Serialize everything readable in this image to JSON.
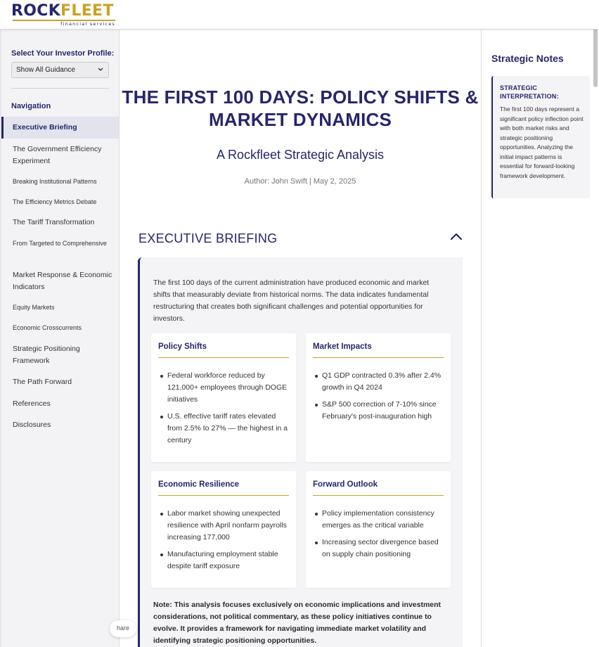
{
  "brand": {
    "name_part1": "ROCK",
    "name_part2": "FLEET",
    "tagline": "financial services",
    "colors": {
      "navy": "#25266b",
      "gold": "#c9a227"
    }
  },
  "sidebar": {
    "profile_label": "Select Your Investor Profile:",
    "profile_selected": "Show All Guidance",
    "nav_heading": "Navigation",
    "items": [
      {
        "label": "Executive Briefing",
        "active": true
      },
      {
        "label": "The Government Efficiency Experiment"
      },
      {
        "label": "Breaking Institutional Patterns"
      },
      {
        "label": "The Efficiency Metrics Debate"
      },
      {
        "label": "The Tariff Transformation"
      },
      {
        "label": "From Targeted to Comprehensive"
      },
      {
        "label": "Market Response & Economic Indicators"
      },
      {
        "label": "Equity Markets"
      },
      {
        "label": "Economic Crosscurrents"
      },
      {
        "label": "Strategic Positioning Framework"
      },
      {
        "label": "The Path Forward"
      },
      {
        "label": "References"
      },
      {
        "label": "Disclosures"
      }
    ],
    "share_label": "hare"
  },
  "main": {
    "title": "THE FIRST 100 DAYS: POLICY SHIFTS & MARKET DYNAMICS",
    "subtitle": "A Rockfleet Strategic Analysis",
    "byline": "Author: John Swift | May 2, 2025",
    "section_heading": "EXECUTIVE BRIEFING",
    "intro": "The first 100 days of the current administration have produced economic and market shifts that measurably deviate from historical norms. The data indicates fundamental restructuring that creates both significant challenges and potential opportunities for investors.",
    "cards": [
      {
        "title": "Policy Shifts",
        "bullets": [
          "Federal workforce reduced by 121,000+ employees through DOGE initiatives",
          "U.S. effective tariff rates elevated from 2.5% to 27% — the highest in a century"
        ]
      },
      {
        "title": "Market Impacts",
        "bullets": [
          "Q1 GDP contracted 0.3% after 2.4% growth in Q4 2024",
          "S&P 500 correction of 7-10% since February's post-inauguration high"
        ]
      },
      {
        "title": "Economic Resilience",
        "bullets": [
          "Labor market showing unexpected resilience with April nonfarm payrolls increasing 177,000",
          "Manufacturing employment stable despite tariff exposure"
        ]
      },
      {
        "title": "Forward Outlook",
        "bullets": [
          "Policy implementation consistency emerges as the critical variable",
          "Increasing sector divergence based on supply chain positioning"
        ]
      }
    ],
    "note": "Note: This analysis focuses exclusively on economic implications and investment considerations, not political commentary, as these policy initiatives continue to evolve. It provides a framework for navigating immediate market volatility and identifying strategic positioning opportunities."
  },
  "notes": {
    "heading": "Strategic Notes",
    "card_title": "STRATEGIC INTERPRETATION:",
    "card_body": "The first 100 days represent a significant policy inflection point with both market risks and strategic positioning opportunities. Analyzing the initial impact patterns is essential for forward-looking framework development."
  }
}
